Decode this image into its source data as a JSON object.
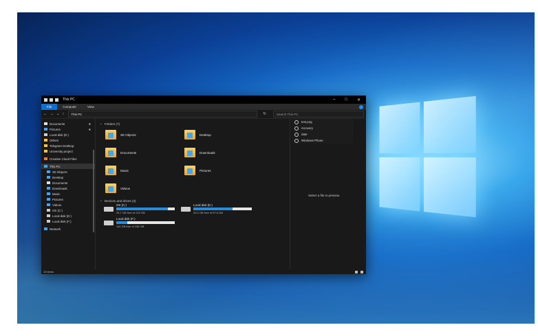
{
  "window": {
    "title": "This PC"
  },
  "ribbon": {
    "tabs": [
      "File",
      "Computer",
      "View"
    ]
  },
  "address": {
    "path": "This PC",
    "search_placeholder": "Search This PC"
  },
  "nav": [
    {
      "label": "Documents",
      "pinned": true,
      "color": "#e0e0e0"
    },
    {
      "label": "Pictures",
      "pinned": true,
      "color": "#4aa3e8"
    },
    {
      "label": "Local disk (E:)",
      "pinned": false,
      "color": "#cfcfcf"
    },
    {
      "label": "Others",
      "pinned": false,
      "color": "#f2c14e"
    },
    {
      "label": "Telegram Desktop",
      "pinned": false,
      "color": "#f2c14e"
    },
    {
      "label": "University project",
      "pinned": false,
      "color": "#f2c14e"
    },
    {
      "label": "Creative Cloud Files",
      "pinned": false,
      "color": "#e0803a"
    },
    {
      "label": "This PC",
      "pinned": false,
      "color": "#4aa3e8"
    },
    {
      "label": "3D Objects",
      "pinned": false,
      "color": "#4aa3e8"
    },
    {
      "label": "Desktop",
      "pinned": false,
      "color": "#4aa3e8"
    },
    {
      "label": "Documents",
      "pinned": false,
      "color": "#e0e0e0"
    },
    {
      "label": "Downloads",
      "pinned": false,
      "color": "#4aa3e8"
    },
    {
      "label": "Music",
      "pinned": false,
      "color": "#4aa3e8"
    },
    {
      "label": "Pictures",
      "pinned": false,
      "color": "#4aa3e8"
    },
    {
      "label": "Videos",
      "pinned": false,
      "color": "#4aa3e8"
    },
    {
      "label": "OS (C:)",
      "pinned": false,
      "color": "#cfcfcf"
    },
    {
      "label": "Local disk (E:)",
      "pinned": false,
      "color": "#cfcfcf"
    },
    {
      "label": "Local disk (F:)",
      "pinned": false,
      "color": "#cfcfcf"
    },
    {
      "label": "Network",
      "pinned": false,
      "color": "#4aa3e8"
    }
  ],
  "folders_header": "Folders (7)",
  "folders": [
    "3D Objects",
    "Desktop",
    "Documents",
    "Downloads",
    "Music",
    "Pictures",
    "Videos"
  ],
  "drives_header": "Devices and drives (3)",
  "drives": [
    {
      "name": "OS (C:)",
      "free": "25.7 GB free of 222 GB",
      "used_fraction": 0.88
    },
    {
      "name": "Local disk (E:)",
      "free": "32.0 GB free of 97.6 GB",
      "used_fraction": 0.67
    },
    {
      "name": "Local disk (F:)",
      "free": "110 GB free of 136 GB",
      "used_fraction": 0.19
    }
  ],
  "recent": [
    "test.png",
    "recovery",
    "date",
    "Windows Phone"
  ],
  "preview_message": "Select a file to preview.",
  "status": {
    "items": "10 items"
  }
}
